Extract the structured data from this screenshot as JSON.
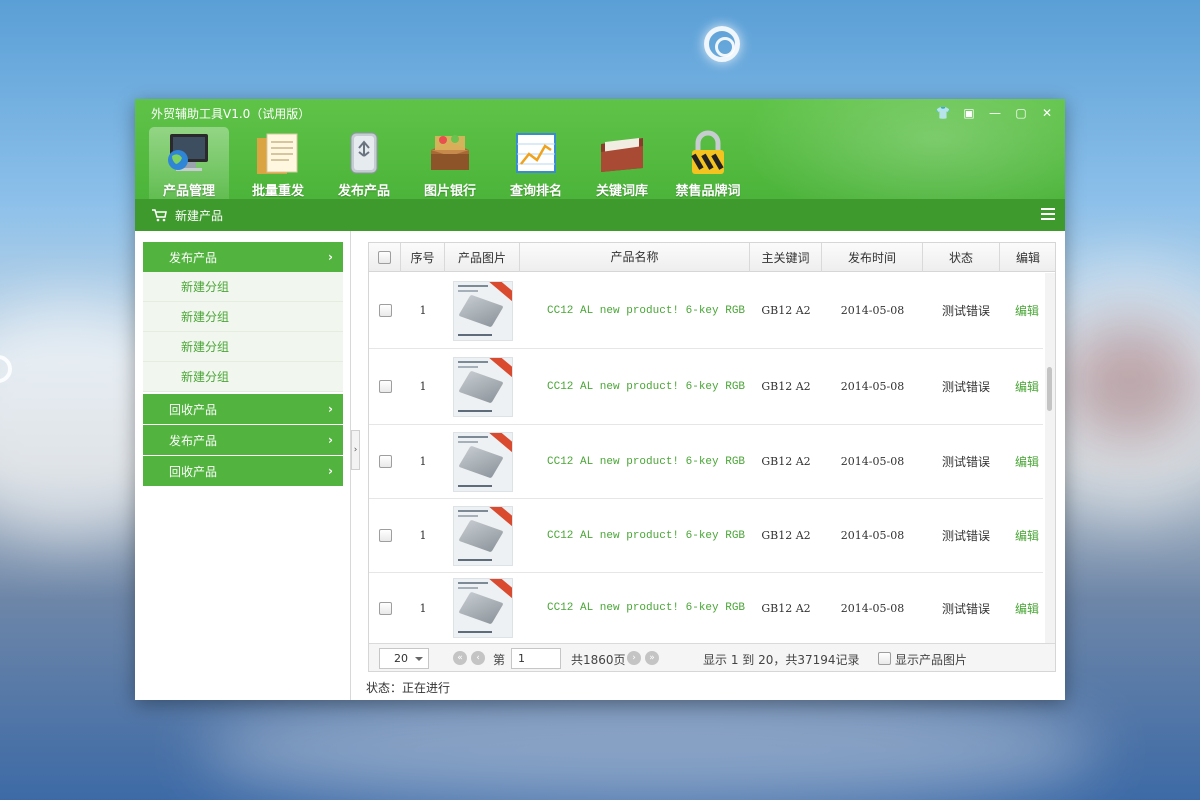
{
  "window": {
    "title": "外贸辅助工具V1.0（试用版）"
  },
  "window_controls": [
    "👕",
    "▣",
    "—",
    "▢",
    "✕"
  ],
  "nav": [
    {
      "label": "产品管理",
      "icon": "monitor-globe-icon",
      "active": true
    },
    {
      "label": "批量重发",
      "icon": "documents-icon",
      "active": false
    },
    {
      "label": "发布产品",
      "icon": "usb-drive-icon",
      "active": false
    },
    {
      "label": "图片银行",
      "icon": "treasure-box-icon",
      "active": false
    },
    {
      "label": "查询排名",
      "icon": "line-chart-icon",
      "active": false
    },
    {
      "label": "关键词库",
      "icon": "file-folder-icon",
      "active": false
    },
    {
      "label": "禁售品牌词",
      "icon": "padlock-icon",
      "active": false
    }
  ],
  "subbar": {
    "crumb": "新建产品"
  },
  "sidebar": {
    "groups": [
      {
        "label": "发布产品"
      },
      {
        "label": "回收产品"
      },
      {
        "label": "发布产品"
      },
      {
        "label": "回收产品"
      }
    ],
    "subitems": [
      "新建分组",
      "新建分组",
      "新建分组",
      "新建分组"
    ]
  },
  "table": {
    "headers": [
      "序号",
      "产品图片",
      "产品名称",
      "主关键词",
      "发布时间",
      "状态",
      "编辑"
    ],
    "rows": [
      {
        "index": "1",
        "name": "CC12 AL  new product! 6-key RGB",
        "keyword": "GB12 A2",
        "date": "2014-05-08",
        "status": "测试错误",
        "edit": "编辑"
      },
      {
        "index": "1",
        "name": "CC12 AL  new product! 6-key RGB",
        "keyword": "GB12 A2",
        "date": "2014-05-08",
        "status": "测试错误",
        "edit": "编辑"
      },
      {
        "index": "1",
        "name": "CC12 AL  new product! 6-key RGB",
        "keyword": "GB12 A2",
        "date": "2014-05-08",
        "status": "测试错误",
        "edit": "编辑"
      },
      {
        "index": "1",
        "name": "CC12 AL  new product! 6-key RGB",
        "keyword": "GB12 A2",
        "date": "2014-05-08",
        "status": "测试错误",
        "edit": "编辑"
      },
      {
        "index": "1",
        "name": "CC12 AL  new product! 6-key RGB",
        "keyword": "GB12 A2",
        "date": "2014-05-08",
        "status": "测试错误",
        "edit": "编辑"
      }
    ]
  },
  "pager": {
    "page_size": "20",
    "page_label": "第",
    "page_value": "1",
    "total_pages": "共1860页",
    "summary": "显示 1 到 20，共37194记录",
    "show_images_label": "显示产品图片"
  },
  "status_bar": {
    "text": "状态：正在进行"
  },
  "colors": {
    "brand_green": "#52b43f",
    "dark_green": "#3f9a2e",
    "link_green": "#4aa637"
  }
}
